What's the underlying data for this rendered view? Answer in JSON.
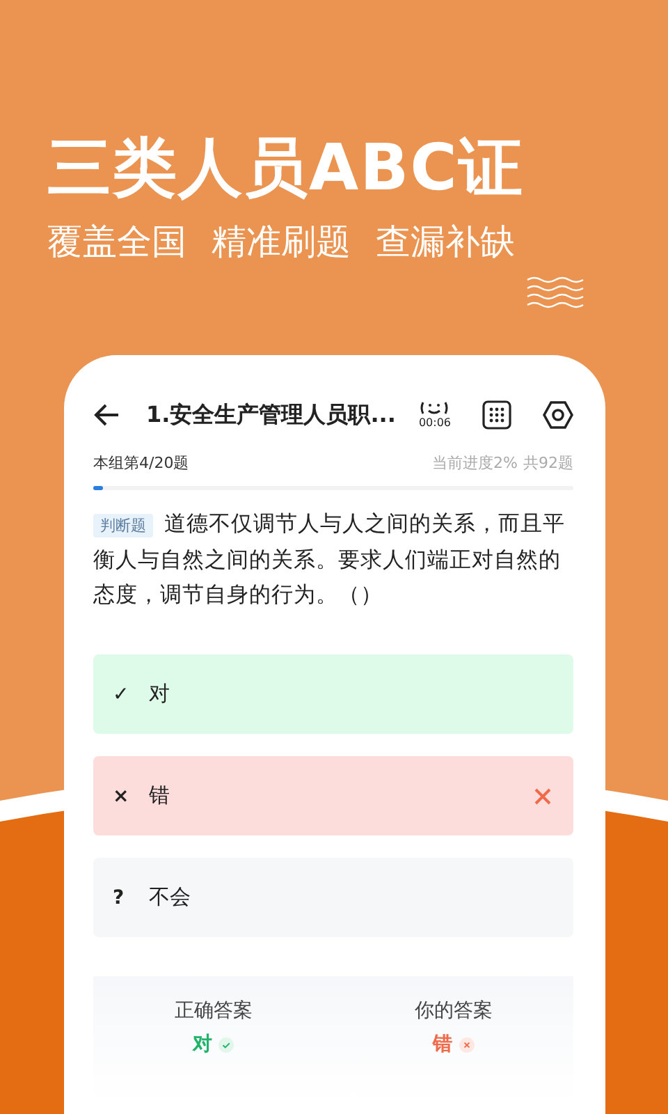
{
  "headline": "三类人员ABC证",
  "tagline": [
    "覆盖全国",
    "精准刷题",
    "查漏补缺"
  ],
  "phone": {
    "title": "1.安全生产管理人员职...",
    "timer": "00:06",
    "progress": {
      "group": "本组第4/20题",
      "current": "当前进度2%",
      "total": "共92题",
      "level": 0.02
    },
    "question": {
      "type": "判断题",
      "text": "道德不仅调节人与人之间的关系，而且平衡人与自然之间的关系。要求人们端正对自然的态度，调节自身的行为。（）"
    },
    "options": [
      {
        "mark": "✓",
        "label": "对",
        "kind": "correct",
        "selected": false
      },
      {
        "mark": "×",
        "label": "错",
        "kind": "wrong",
        "selected": true
      },
      {
        "mark": "?",
        "label": "不会",
        "kind": "neutral",
        "selected": false
      }
    ],
    "summary": [
      {
        "label": "正确答案",
        "value": "对",
        "kind": "correct"
      },
      {
        "label": "你的答案",
        "value": "错",
        "kind": "wrong"
      }
    ]
  }
}
